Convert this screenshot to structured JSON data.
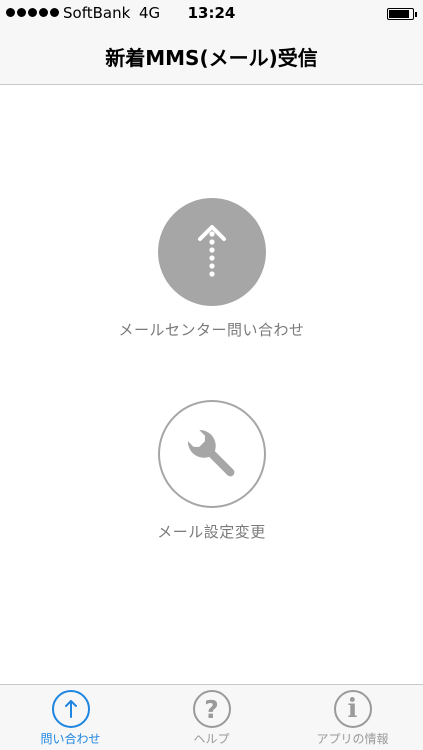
{
  "status_bar": {
    "carrier": "SoftBank",
    "network": "4G",
    "time": "13:24",
    "signal_bars": 5,
    "battery_level": 0.85
  },
  "nav": {
    "title": "新着MMS(メール)受信"
  },
  "actions": {
    "inquiry": {
      "label": "メールセンター問い合わせ",
      "icon": "dotted-up-arrow-icon"
    },
    "settings": {
      "label": "メール設定変更",
      "icon": "wrench-icon"
    }
  },
  "tabs": [
    {
      "label": "問い合わせ",
      "icon": "up-arrow-icon",
      "active": true
    },
    {
      "label": "ヘルプ",
      "icon": "question-mark-icon",
      "active": false
    },
    {
      "label": "アプリの情報",
      "icon": "info-icon",
      "active": false
    }
  ],
  "colors": {
    "accent": "#1e86e0",
    "icon_gray": "#a6a6a6",
    "label_gray": "#7a7a7a",
    "bar_background": "#f7f7f7"
  }
}
